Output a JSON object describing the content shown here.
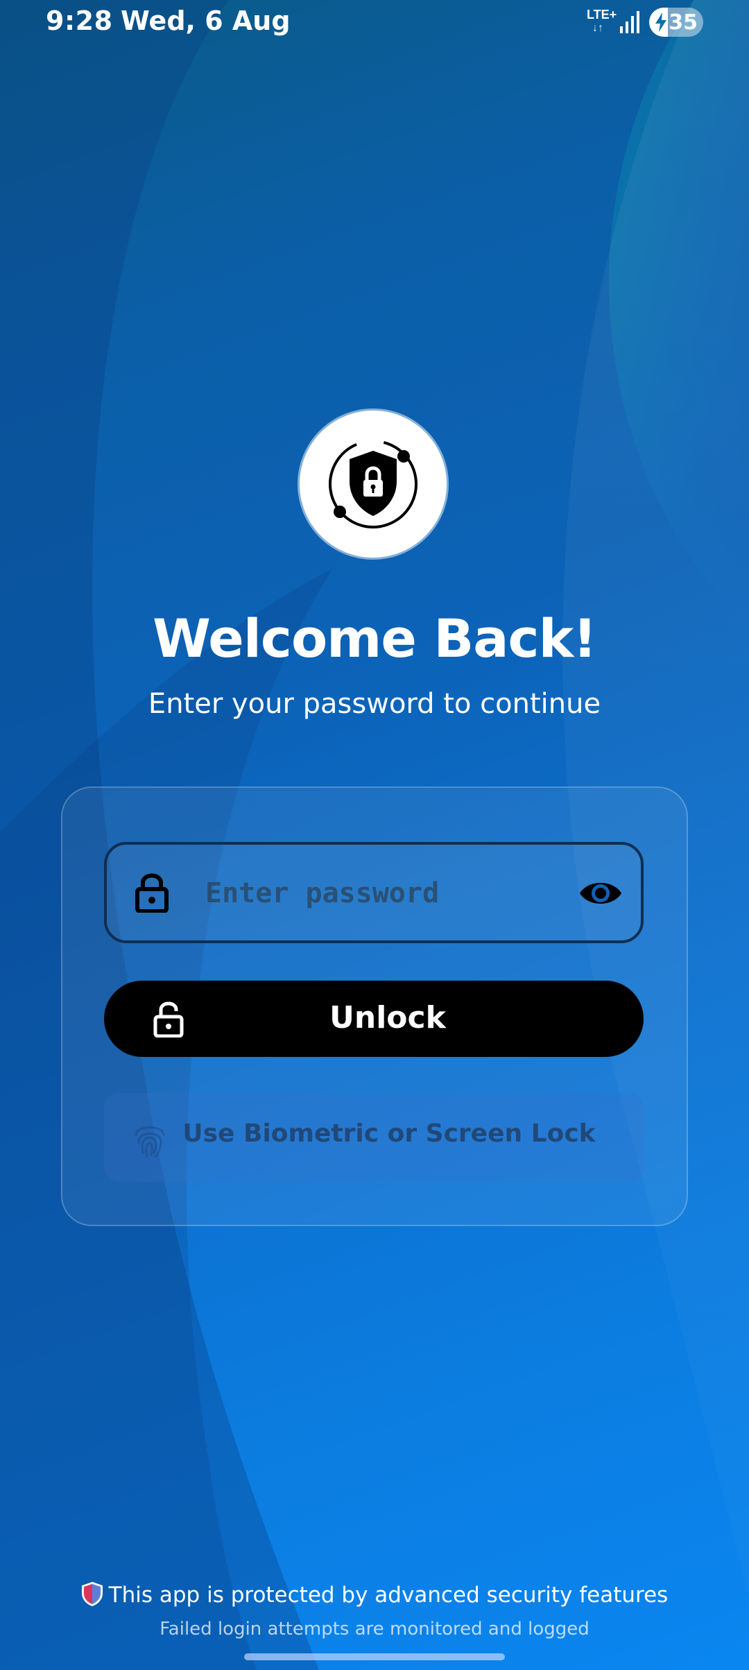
{
  "status_bar": {
    "time": "9:28",
    "date": "Wed, 6 Aug",
    "network": "LTE+",
    "battery_level": "35",
    "battery_fraction": 0.35
  },
  "logo": {
    "icon": "shield-lock-icon"
  },
  "header": {
    "title": "Welcome Back!",
    "subtitle": "Enter your password to continue"
  },
  "form": {
    "password_placeholder": "Enter password",
    "password_value": "",
    "unlock_label": "Unlock",
    "biometric_label": "Use Biometric or Screen Lock"
  },
  "footer": {
    "security_note": "This app is protected by advanced security features",
    "monitor_note": "Failed login attempts are monitored and logged"
  },
  "colors": {
    "accent": "#000000",
    "field_border": "#0d2f52"
  }
}
